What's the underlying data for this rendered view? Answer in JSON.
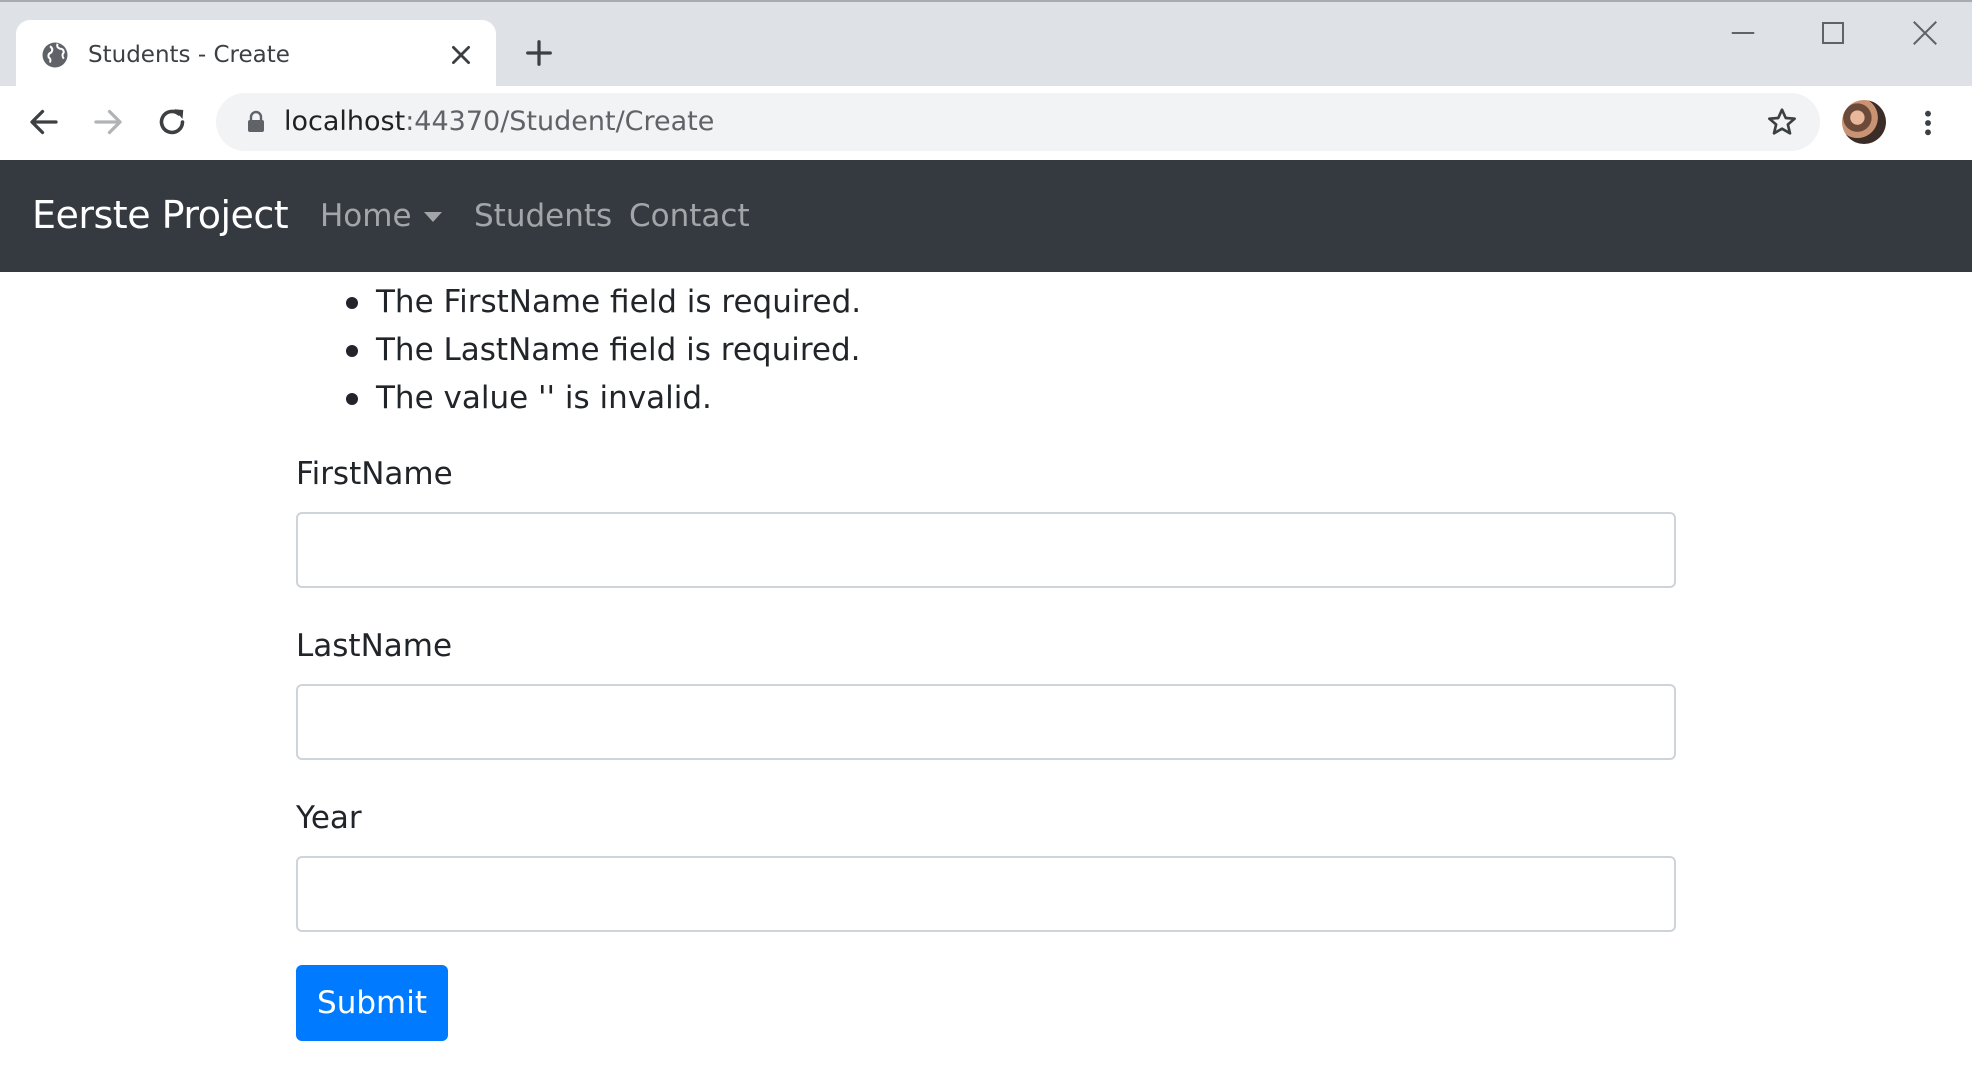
{
  "browser": {
    "tab_title": "Students - Create",
    "url_host": "localhost",
    "url_rest": ":44370/Student/Create"
  },
  "navbar": {
    "brand": "Eerste Project",
    "links": [
      {
        "label": "Home",
        "has_dropdown": true
      },
      {
        "label": "Students",
        "has_dropdown": false
      },
      {
        "label": "Contact",
        "has_dropdown": false
      }
    ]
  },
  "validation_errors": [
    "The FirstName field is required.",
    "The LastName field is required.",
    "The value '' is invalid."
  ],
  "form": {
    "fields": [
      {
        "label": "FirstName",
        "value": ""
      },
      {
        "label": "LastName",
        "value": ""
      },
      {
        "label": "Year",
        "value": ""
      }
    ],
    "submit_label": "Submit"
  },
  "colors": {
    "navbar_bg": "#343a40",
    "primary": "#007bff",
    "tabstrip_bg": "#dee1e6"
  },
  "icons": [
    "globe-icon",
    "close-icon",
    "plus-icon",
    "minimize-icon",
    "maximize-icon",
    "window-close-icon",
    "back-arrow-icon",
    "forward-arrow-icon",
    "reload-icon",
    "lock-icon",
    "star-icon",
    "more-vert-icon"
  ]
}
